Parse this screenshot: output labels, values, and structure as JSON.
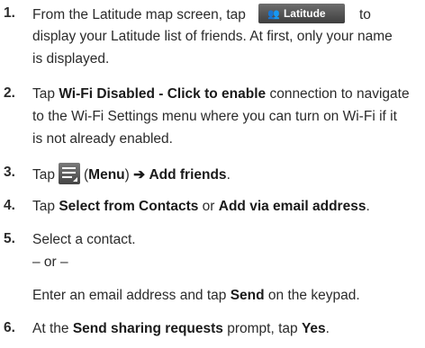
{
  "steps": [
    {
      "number": "1.",
      "line1_pre": "From the Latitude map screen, tap",
      "button_label": "Latitude",
      "button_icon": "people-icon",
      "line1_post": "to",
      "line2": "display your Latitude list of friends. At first, only your name",
      "line3": "is displayed."
    },
    {
      "number": "2.",
      "pre": "Tap ",
      "bold": "Wi-Fi Disabled - Click to enable",
      "post": " connection to navigate",
      "line2": "to the Wi-Fi Settings menu where you can turn on Wi-Fi if it",
      "line3": "is not already enabled."
    },
    {
      "number": "3.",
      "pre": "Tap",
      "icon": "menu-icon",
      "paren_open": "(",
      "bold1": "Menu",
      "paren_close": ")",
      "arrow": "➔",
      "bold2": "Add friends",
      "end": "."
    },
    {
      "number": "4.",
      "pre": "Tap ",
      "bold1": "Select from Contacts",
      "mid": " or ",
      "bold2": "Add via email address",
      "end": "."
    },
    {
      "number": "5.",
      "line1": "Select a contact.",
      "or": "– or –",
      "line3_pre": "Enter an email address and tap ",
      "line3_bold": "Send",
      "line3_post": " on the keypad."
    },
    {
      "number": "6.",
      "pre": "At the ",
      "bold1": "Send sharing requests",
      "mid": " prompt, tap ",
      "bold2": "Yes",
      "end": "."
    }
  ]
}
